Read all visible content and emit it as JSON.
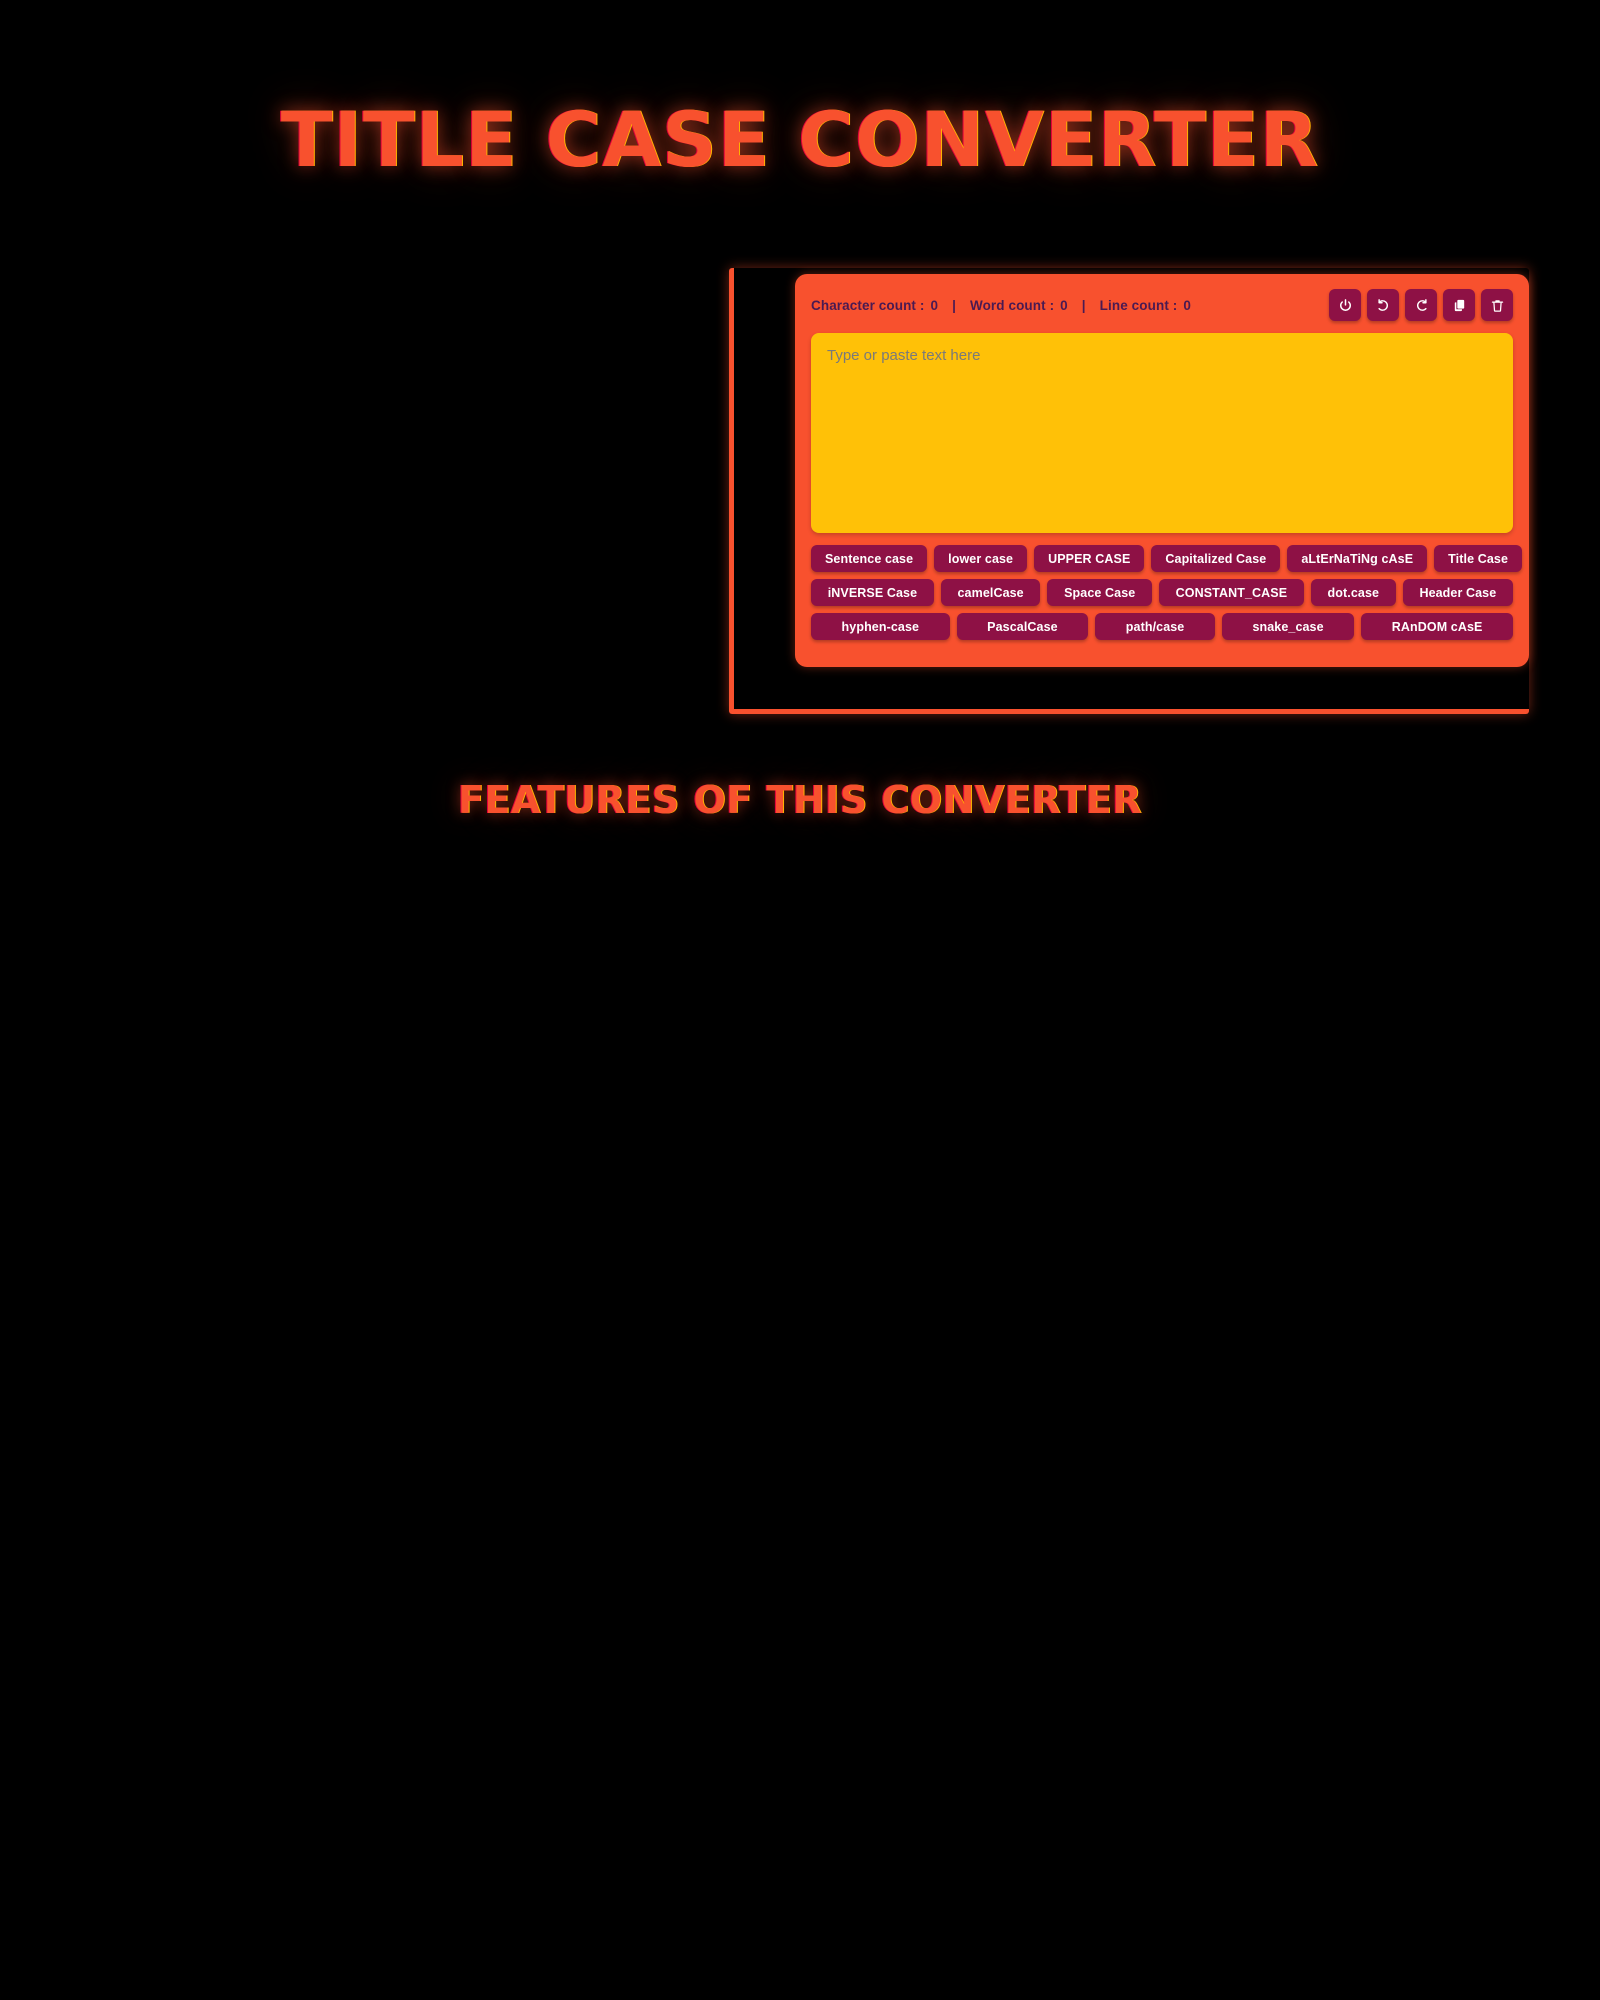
{
  "page": {
    "title": "TITLE CASE CONVERTER",
    "features_heading": "FEATURES OF THIS CONVERTER",
    "background_color": "#000000",
    "accent_color": "#F8512E",
    "button_color": "#8E1145",
    "textarea_color": "#FFC107"
  },
  "card": {
    "counters": {
      "character": {
        "label": "Character count :",
        "value": "0"
      },
      "separator_1": "|",
      "word": {
        "label": "Word count :",
        "value": "0"
      },
      "separator_2": "|",
      "line": {
        "label": "Line count :",
        "value": "0"
      }
    },
    "icon_buttons": [
      {
        "name": "power-icon",
        "title": "Power"
      },
      {
        "name": "undo-icon",
        "title": "Undo"
      },
      {
        "name": "redo-icon",
        "title": "Redo"
      },
      {
        "name": "copy-icon",
        "title": "Copy"
      },
      {
        "name": "trash-icon",
        "title": "Clear"
      }
    ],
    "textarea": {
      "placeholder": "Type or paste text here",
      "value": ""
    },
    "case_buttons": {
      "row_1": [
        "Sentence case",
        "lower case",
        "UPPER CASE",
        "Capitalized Case",
        "aLtErNaTiNg cAsE",
        "Title Case"
      ],
      "row_2": [
        "iNVERSE Case",
        "camelCase",
        "Space Case",
        "CONSTANT_CASE",
        "dot.case",
        "Header Case"
      ],
      "row_3": [
        "hyphen-case",
        "PascalCase",
        "path/case",
        "snake_case",
        "RAnDOM cAsE"
      ]
    }
  }
}
